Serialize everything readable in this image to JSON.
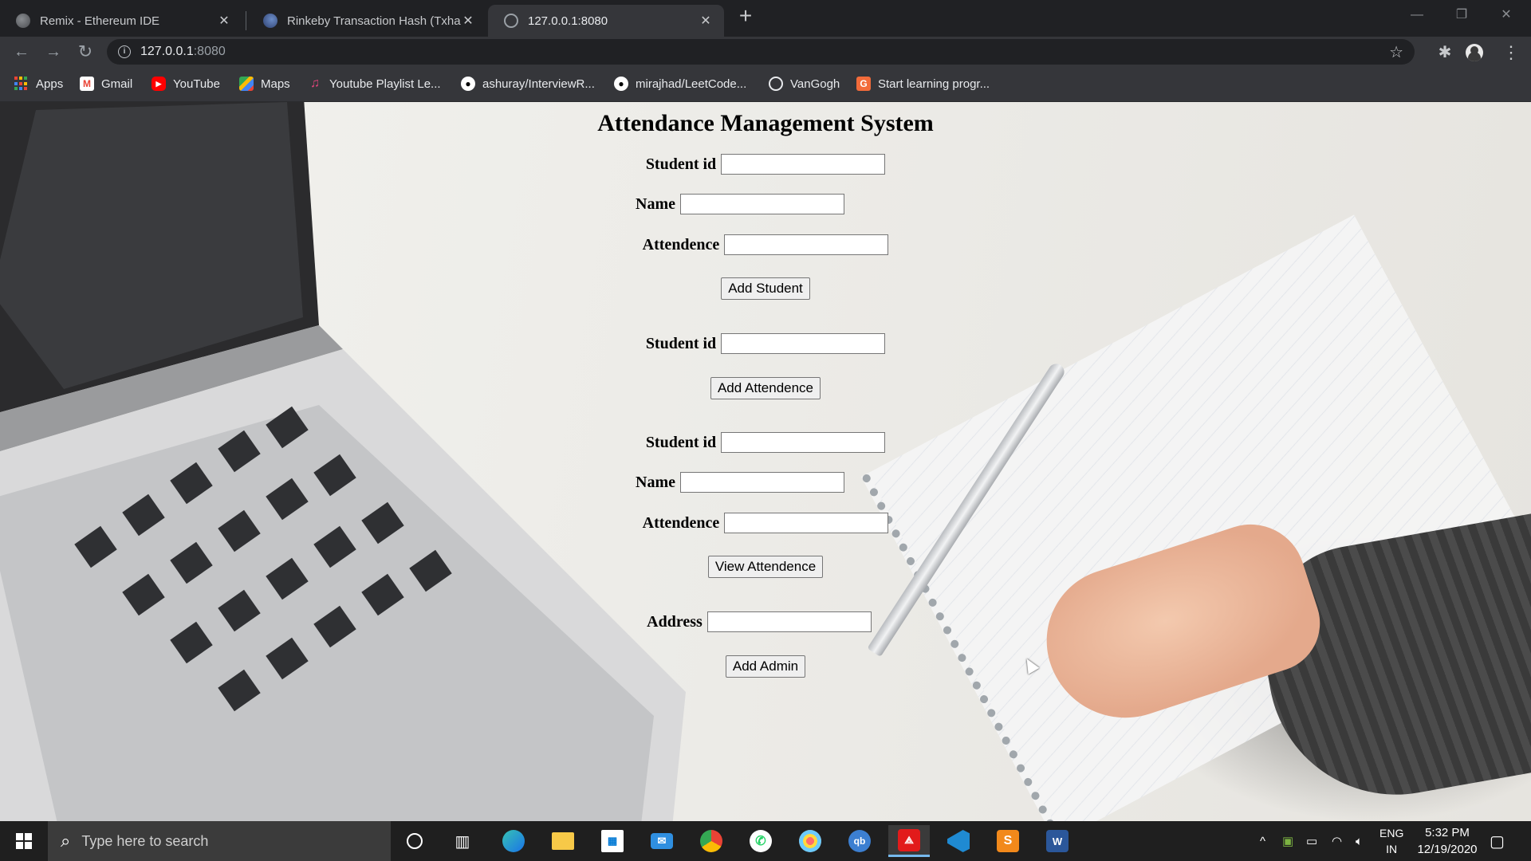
{
  "browser": {
    "tabs": [
      {
        "title": "Remix - Ethereum IDE",
        "icon": "remix-icon",
        "active": false
      },
      {
        "title": "Rinkeby Transaction Hash (Txhash",
        "icon": "etherscan-icon",
        "active": false
      },
      {
        "title": "127.0.0.1:8080",
        "icon": "globe-icon",
        "active": true
      }
    ],
    "url_host": "127.0.0.1",
    "url_port": ":8080",
    "bookmarks": [
      {
        "label": "Apps",
        "icon": "apps-grid-icon"
      },
      {
        "label": "Gmail",
        "icon": "gmail-icon"
      },
      {
        "label": "YouTube",
        "icon": "youtube-icon"
      },
      {
        "label": "Maps",
        "icon": "maps-icon"
      },
      {
        "label": "Youtube Playlist Le...",
        "icon": "playlist-icon"
      },
      {
        "label": "ashuray/InterviewR...",
        "icon": "github-icon"
      },
      {
        "label": "mirajhad/LeetCode...",
        "icon": "github-icon"
      },
      {
        "label": "VanGogh",
        "icon": "globe-icon"
      },
      {
        "label": "Start learning progr...",
        "icon": "learning-icon"
      }
    ]
  },
  "page": {
    "heading": "Attendance Management System",
    "section_add_student": {
      "fields": [
        {
          "label": "Student id",
          "value": ""
        },
        {
          "label": "Name",
          "value": ""
        },
        {
          "label": "Attendence",
          "value": ""
        }
      ],
      "button": "Add Student"
    },
    "section_add_attendence": {
      "fields": [
        {
          "label": "Student id",
          "value": ""
        }
      ],
      "button": "Add Attendence"
    },
    "section_view_attendence": {
      "fields": [
        {
          "label": "Student id",
          "value": ""
        },
        {
          "label": "Name",
          "value": ""
        },
        {
          "label": "Attendence",
          "value": ""
        }
      ],
      "button": "View Attendence"
    },
    "section_add_admin": {
      "fields": [
        {
          "label": "Address",
          "value": ""
        }
      ],
      "button": "Add Admin"
    }
  },
  "taskbar": {
    "search_placeholder": "Type here to search",
    "language_top": "ENG",
    "language_bottom": "IN",
    "time": "5:32 PM",
    "date": "12/19/2020"
  },
  "colors": {
    "browser_dark": "#202124",
    "toolbar": "#35363a",
    "taskbar": "#1f1f1f",
    "accent": "#76b9ed"
  }
}
